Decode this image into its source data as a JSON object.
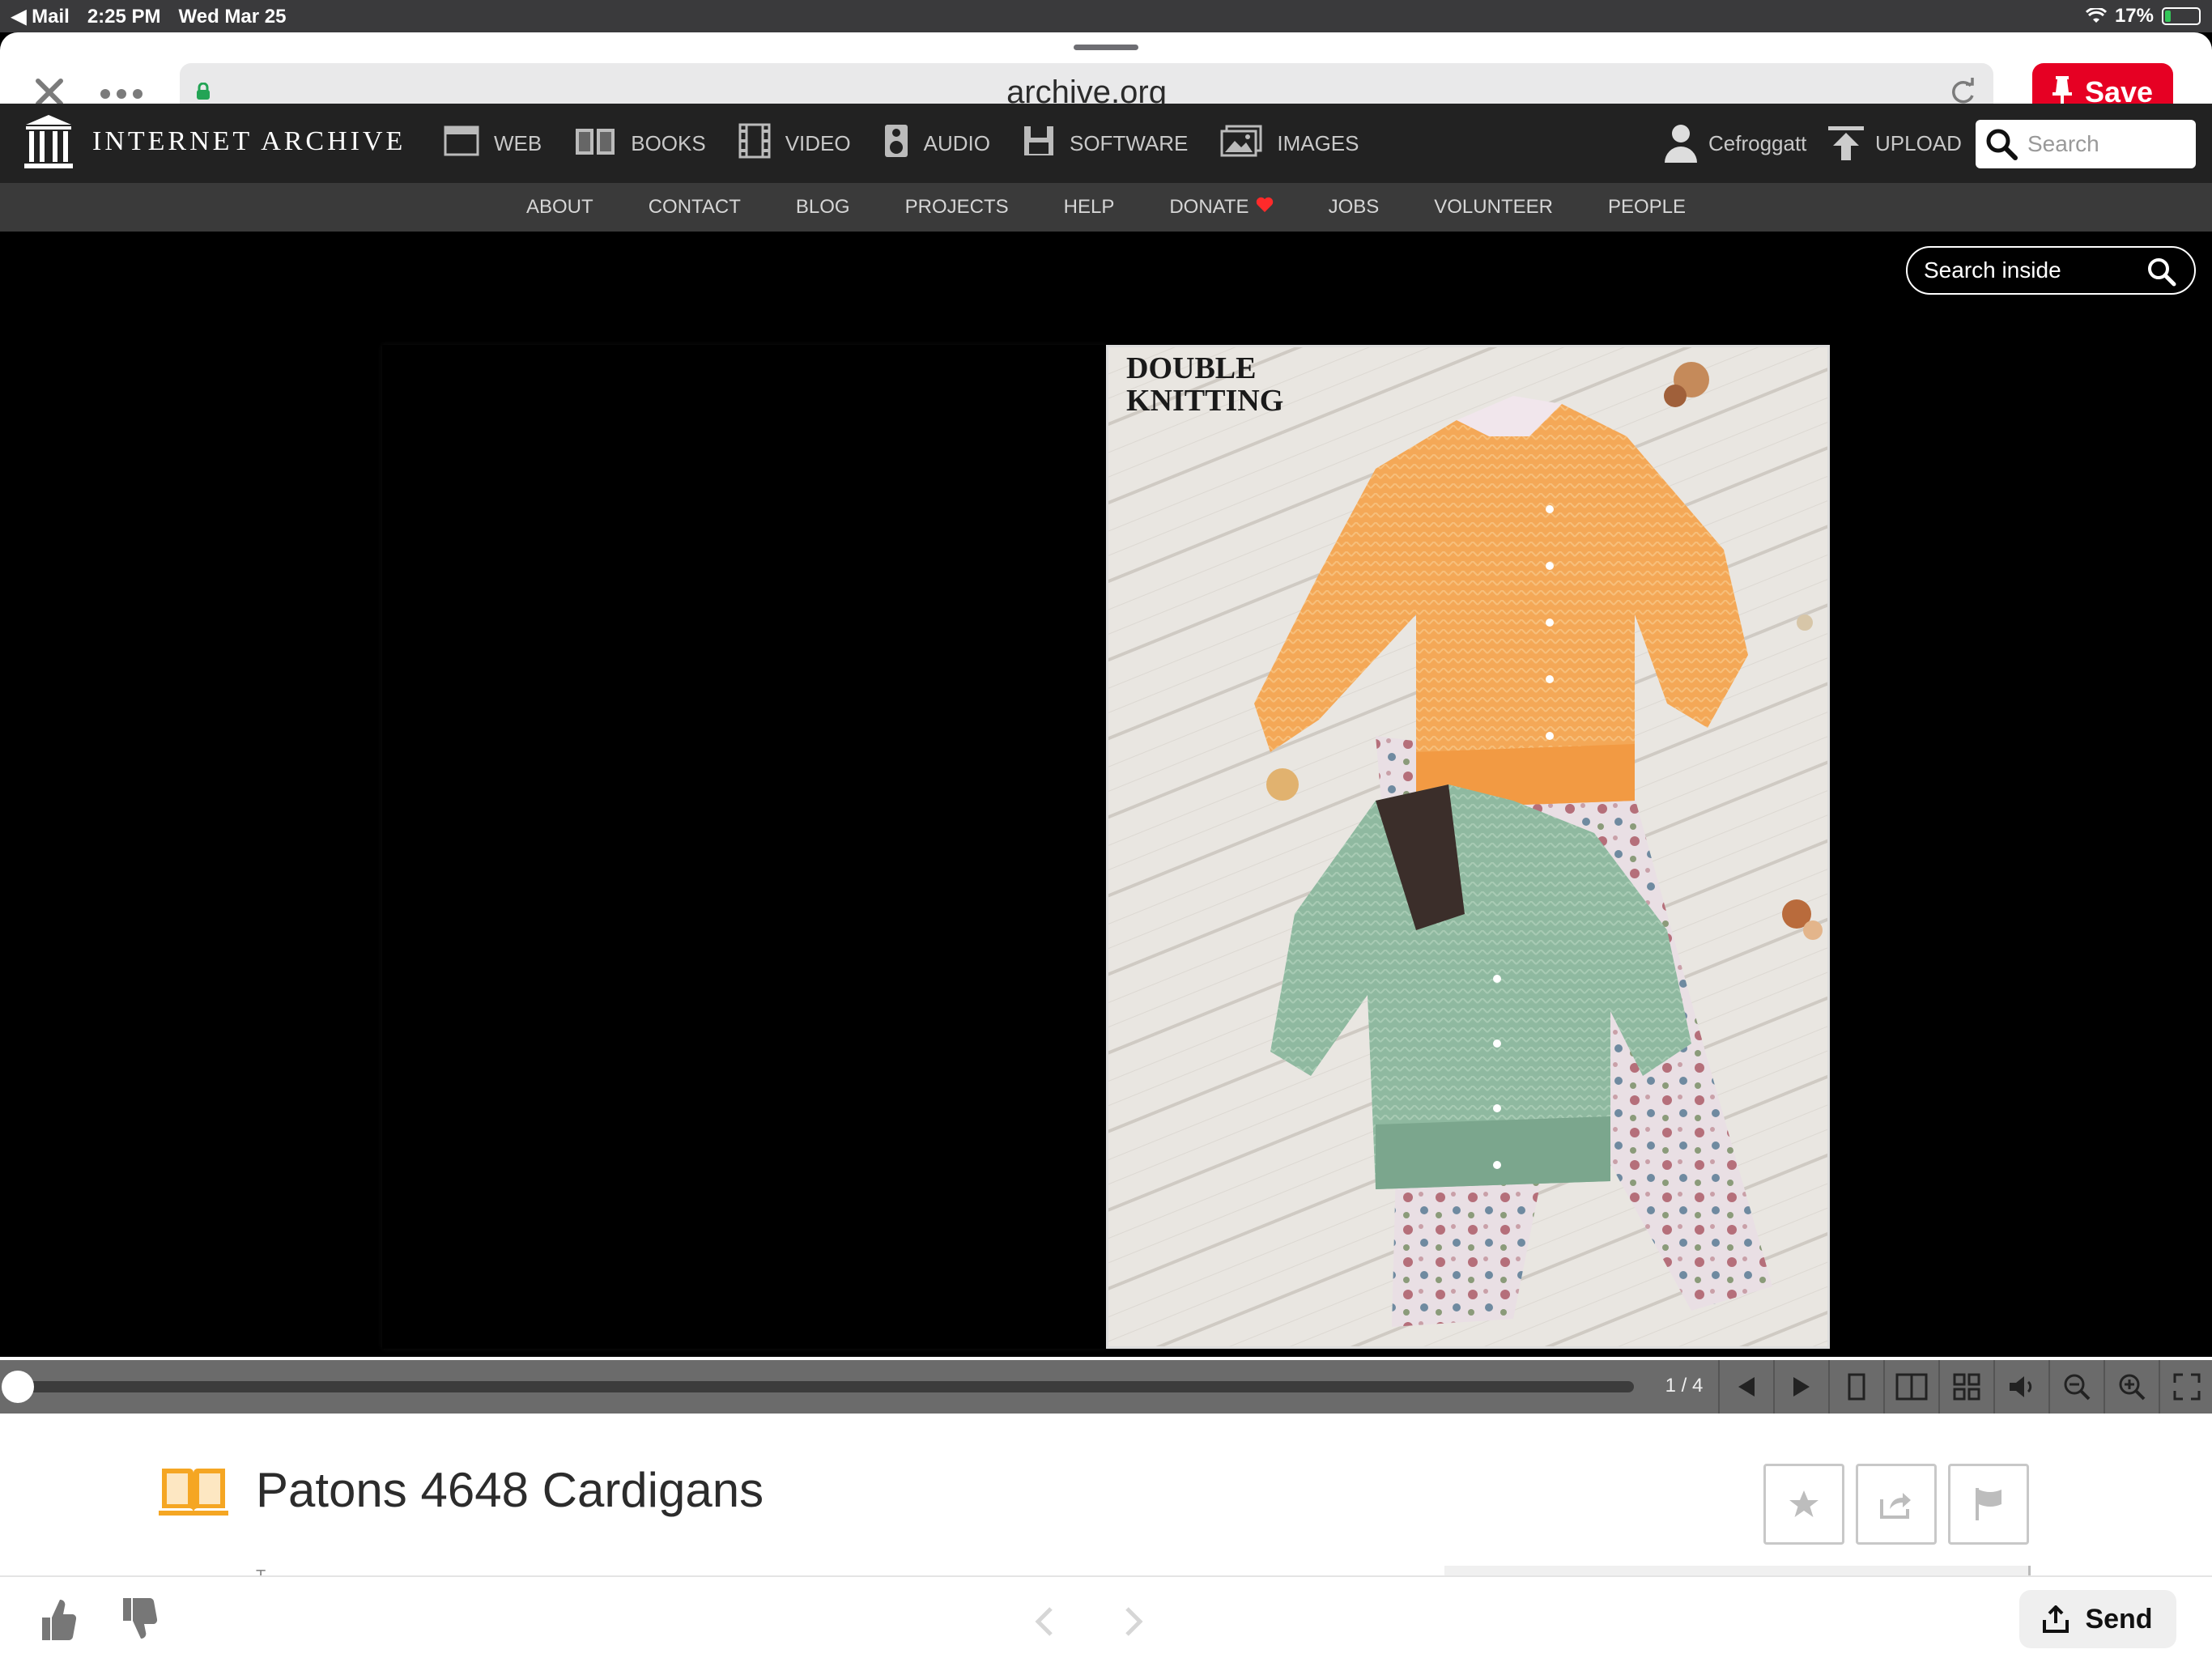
{
  "status_bar": {
    "back_app": "Mail",
    "time": "2:25 PM",
    "date": "Wed Mar 25",
    "battery": "17%",
    "battery_level": 0.17
  },
  "browser": {
    "url": "archive.org",
    "save_label": "Save"
  },
  "ia_header": {
    "logo_text": "INTERNET ARCHIVE",
    "media": [
      {
        "label": "WEB",
        "icon": "web-icon"
      },
      {
        "label": "BOOKS",
        "icon": "books-icon"
      },
      {
        "label": "VIDEO",
        "icon": "video-icon"
      },
      {
        "label": "AUDIO",
        "icon": "audio-icon"
      },
      {
        "label": "SOFTWARE",
        "icon": "software-icon"
      },
      {
        "label": "IMAGES",
        "icon": "images-icon"
      }
    ],
    "username": "Cefroggatt",
    "upload_label": "UPLOAD",
    "search_placeholder": "Search"
  },
  "ia_subnav": [
    "ABOUT",
    "CONTACT",
    "BLOG",
    "PROJECTS",
    "HELP",
    "DONATE",
    "JOBS",
    "VOLUNTEER",
    "PEOPLE"
  ],
  "reader": {
    "search_inside_placeholder": "Search inside",
    "cover_title_line1": "DOUBLE",
    "cover_title_line2": "KNITTING",
    "page_indicator": "1 / 4",
    "progress": 0.0
  },
  "item": {
    "title": "Patons 4648 Cardigans",
    "description_partial": "T..."
  },
  "bottom_bar": {
    "send_label": "Send"
  },
  "colors": {
    "save_red": "#e60023",
    "ia_dark": "#222222",
    "book_orange": "#f5a623"
  }
}
